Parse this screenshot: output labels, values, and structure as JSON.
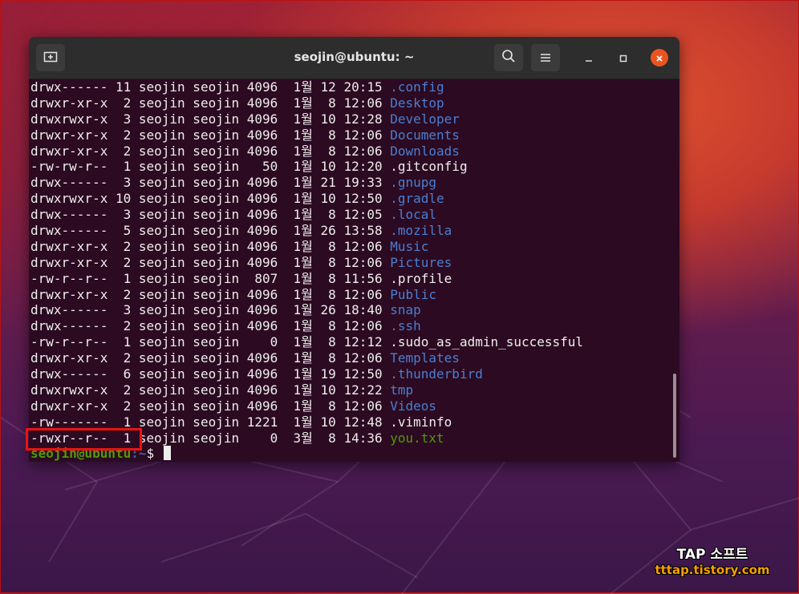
{
  "window": {
    "title": "seojin@ubuntu: ~"
  },
  "colors": {
    "accent": "#e95420",
    "dir": "#4a7fd0",
    "exec": "#4e9a06",
    "highlight": "#ee1111"
  },
  "icons": {
    "new_tab": "new-tab-icon",
    "search": "search-icon",
    "menu": "hamburger-menu-icon",
    "minimize": "minimize-icon",
    "maximize": "maximize-icon",
    "close": "close-icon"
  },
  "listing": [
    {
      "perm": "drwx------",
      "links": "11",
      "owner": "seojin",
      "group": "seojin",
      "size": "4096",
      "month": "1월",
      "day": "12",
      "time": "20:15",
      "name": "config",
      "display": ".config",
      "kind": "dir"
    },
    {
      "perm": "drwxr-xr-x",
      "links": " 2",
      "owner": "seojin",
      "group": "seojin",
      "size": "4096",
      "month": "1월",
      "day": " 8",
      "time": "12:06",
      "display": "Desktop",
      "kind": "dir"
    },
    {
      "perm": "drwxrwxr-x",
      "links": " 3",
      "owner": "seojin",
      "group": "seojin",
      "size": "4096",
      "month": "1월",
      "day": "10",
      "time": "12:28",
      "display": "Developer",
      "kind": "dir"
    },
    {
      "perm": "drwxr-xr-x",
      "links": " 2",
      "owner": "seojin",
      "group": "seojin",
      "size": "4096",
      "month": "1월",
      "day": " 8",
      "time": "12:06",
      "display": "Documents",
      "kind": "dir"
    },
    {
      "perm": "drwxr-xr-x",
      "links": " 2",
      "owner": "seojin",
      "group": "seojin",
      "size": "4096",
      "month": "1월",
      "day": " 8",
      "time": "12:06",
      "display": "Downloads",
      "kind": "dir"
    },
    {
      "perm": "-rw-rw-r--",
      "links": " 1",
      "owner": "seojin",
      "group": "seojin",
      "size": "  50",
      "month": "1월",
      "day": "10",
      "time": "12:20",
      "display": ".gitconfig",
      "kind": "file"
    },
    {
      "perm": "drwx------",
      "links": " 3",
      "owner": "seojin",
      "group": "seojin",
      "size": "4096",
      "month": "1월",
      "day": "21",
      "time": "19:33",
      "display": ".gnupg",
      "kind": "dir"
    },
    {
      "perm": "drwxrwxr-x",
      "links": "10",
      "owner": "seojin",
      "group": "seojin",
      "size": "4096",
      "month": "1월",
      "day": "10",
      "time": "12:50",
      "display": ".gradle",
      "kind": "dir"
    },
    {
      "perm": "drwx------",
      "links": " 3",
      "owner": "seojin",
      "group": "seojin",
      "size": "4096",
      "month": "1월",
      "day": " 8",
      "time": "12:05",
      "display": ".local",
      "kind": "dir"
    },
    {
      "perm": "drwx------",
      "links": " 5",
      "owner": "seojin",
      "group": "seojin",
      "size": "4096",
      "month": "1월",
      "day": "26",
      "time": "13:58",
      "display": ".mozilla",
      "kind": "dir"
    },
    {
      "perm": "drwxr-xr-x",
      "links": " 2",
      "owner": "seojin",
      "group": "seojin",
      "size": "4096",
      "month": "1월",
      "day": " 8",
      "time": "12:06",
      "display": "Music",
      "kind": "dir"
    },
    {
      "perm": "drwxr-xr-x",
      "links": " 2",
      "owner": "seojin",
      "group": "seojin",
      "size": "4096",
      "month": "1월",
      "day": " 8",
      "time": "12:06",
      "display": "Pictures",
      "kind": "dir"
    },
    {
      "perm": "-rw-r--r--",
      "links": " 1",
      "owner": "seojin",
      "group": "seojin",
      "size": " 807",
      "month": "1월",
      "day": " 8",
      "time": "11:56",
      "display": ".profile",
      "kind": "file"
    },
    {
      "perm": "drwxr-xr-x",
      "links": " 2",
      "owner": "seojin",
      "group": "seojin",
      "size": "4096",
      "month": "1월",
      "day": " 8",
      "time": "12:06",
      "display": "Public",
      "kind": "dir"
    },
    {
      "perm": "drwx------",
      "links": " 3",
      "owner": "seojin",
      "group": "seojin",
      "size": "4096",
      "month": "1월",
      "day": "26",
      "time": "18:40",
      "display": "snap",
      "kind": "dir"
    },
    {
      "perm": "drwx------",
      "links": " 2",
      "owner": "seojin",
      "group": "seojin",
      "size": "4096",
      "month": "1월",
      "day": " 8",
      "time": "12:06",
      "display": ".ssh",
      "kind": "dir"
    },
    {
      "perm": "-rw-r--r--",
      "links": " 1",
      "owner": "seojin",
      "group": "seojin",
      "size": "   0",
      "month": "1월",
      "day": " 8",
      "time": "12:12",
      "display": ".sudo_as_admin_successful",
      "kind": "file"
    },
    {
      "perm": "drwxr-xr-x",
      "links": " 2",
      "owner": "seojin",
      "group": "seojin",
      "size": "4096",
      "month": "1월",
      "day": " 8",
      "time": "12:06",
      "display": "Templates",
      "kind": "dir"
    },
    {
      "perm": "drwx------",
      "links": " 6",
      "owner": "seojin",
      "group": "seojin",
      "size": "4096",
      "month": "1월",
      "day": "19",
      "time": "12:50",
      "display": ".thunderbird",
      "kind": "dir"
    },
    {
      "perm": "drwxrwxr-x",
      "links": " 2",
      "owner": "seojin",
      "group": "seojin",
      "size": "4096",
      "month": "1월",
      "day": "10",
      "time": "12:22",
      "display": "tmp",
      "kind": "dir"
    },
    {
      "perm": "drwxr-xr-x",
      "links": " 2",
      "owner": "seojin",
      "group": "seojin",
      "size": "4096",
      "month": "1월",
      "day": " 8",
      "time": "12:06",
      "display": "Videos",
      "kind": "dir"
    },
    {
      "perm": "-rw-------",
      "links": " 1",
      "owner": "seojin",
      "group": "seojin",
      "size": "1221",
      "month": "1월",
      "day": "10",
      "time": "12:48",
      "display": ".viminfo",
      "kind": "file"
    },
    {
      "perm": "-rwxr--r--",
      "links": " 1",
      "owner": "seojin",
      "group": "seojin",
      "size": "   0",
      "month": "3월",
      "day": " 8",
      "time": "14:36",
      "display": "you.txt",
      "kind": "exec"
    }
  ],
  "prompt": {
    "user_host": "seojin@ubuntu",
    "path": ":~",
    "symbol": "$ "
  },
  "watermark": {
    "title": "TAP 소프트",
    "url": "tttap.tistory.com"
  }
}
